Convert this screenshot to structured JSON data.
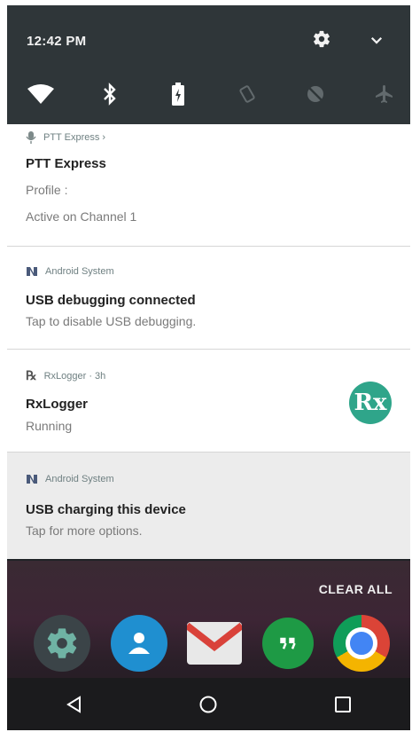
{
  "status": {
    "time": "12:42 PM"
  },
  "quick_settings": {
    "tiles": [
      "wifi-icon",
      "bluetooth-icon",
      "battery-icon",
      "rotation-icon",
      "dnd-icon",
      "airplane-icon"
    ]
  },
  "notifications": [
    {
      "app": "PTT Express",
      "meta": "PTT Express ›",
      "title": "PTT Express",
      "lines": [
        "Profile :",
        "Active on Channel 1"
      ]
    },
    {
      "app": "Android System",
      "title": "USB debugging connected",
      "lines": [
        "Tap to disable USB debugging."
      ]
    },
    {
      "app": "RxLogger · 3h",
      "title": "RxLogger",
      "lines": [
        "Running"
      ],
      "avatar": "Rx"
    },
    {
      "app": "Android System",
      "title": "USB charging this device",
      "lines": [
        "Tap for more options."
      ]
    }
  ],
  "home": {
    "clear_all": "CLEAR ALL"
  },
  "dock": [
    "settings-app-icon",
    "contacts-app-icon",
    "gmail-app-icon",
    "hangouts-app-icon",
    "chrome-app-icon"
  ],
  "colors": {
    "accent_green": "#2fa58a",
    "header_bg": "#2f3639"
  }
}
